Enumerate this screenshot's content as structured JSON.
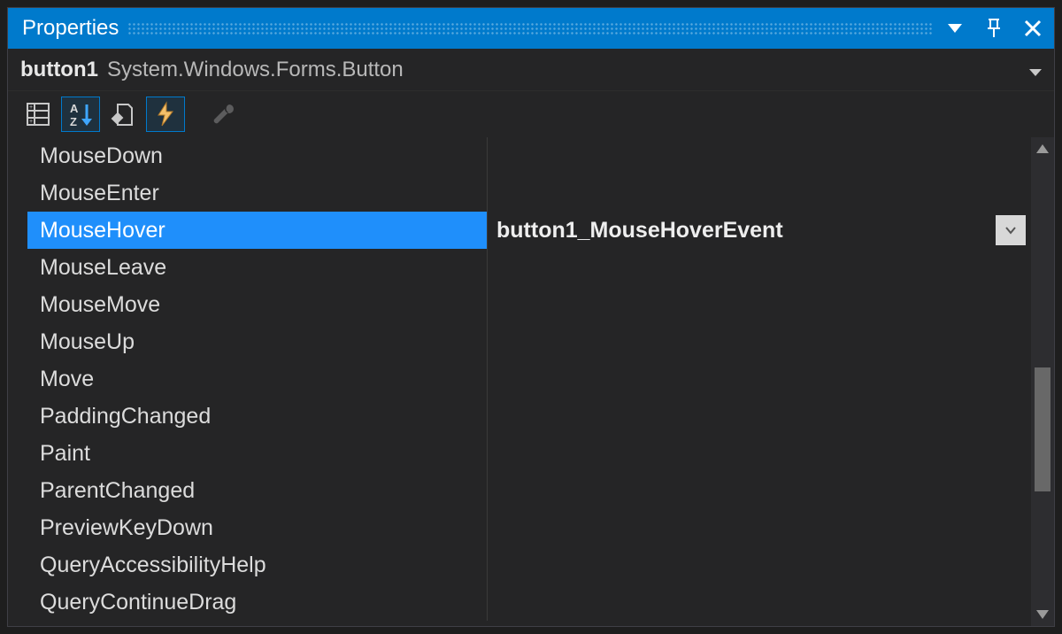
{
  "panel": {
    "title": "Properties"
  },
  "object": {
    "name": "button1",
    "type": "System.Windows.Forms.Button"
  },
  "toolbar": {
    "active_index": [
      1,
      3
    ]
  },
  "events": [
    {
      "name": "MouseDown",
      "value": ""
    },
    {
      "name": "MouseEnter",
      "value": ""
    },
    {
      "name": "MouseHover",
      "value": "button1_MouseHoverEvent",
      "selected": true
    },
    {
      "name": "MouseLeave",
      "value": ""
    },
    {
      "name": "MouseMove",
      "value": ""
    },
    {
      "name": "MouseUp",
      "value": ""
    },
    {
      "name": "Move",
      "value": ""
    },
    {
      "name": "PaddingChanged",
      "value": ""
    },
    {
      "name": "Paint",
      "value": ""
    },
    {
      "name": "ParentChanged",
      "value": ""
    },
    {
      "name": "PreviewKeyDown",
      "value": ""
    },
    {
      "name": "QueryAccessibilityHelp",
      "value": ""
    },
    {
      "name": "QueryContinueDrag",
      "value": ""
    }
  ]
}
